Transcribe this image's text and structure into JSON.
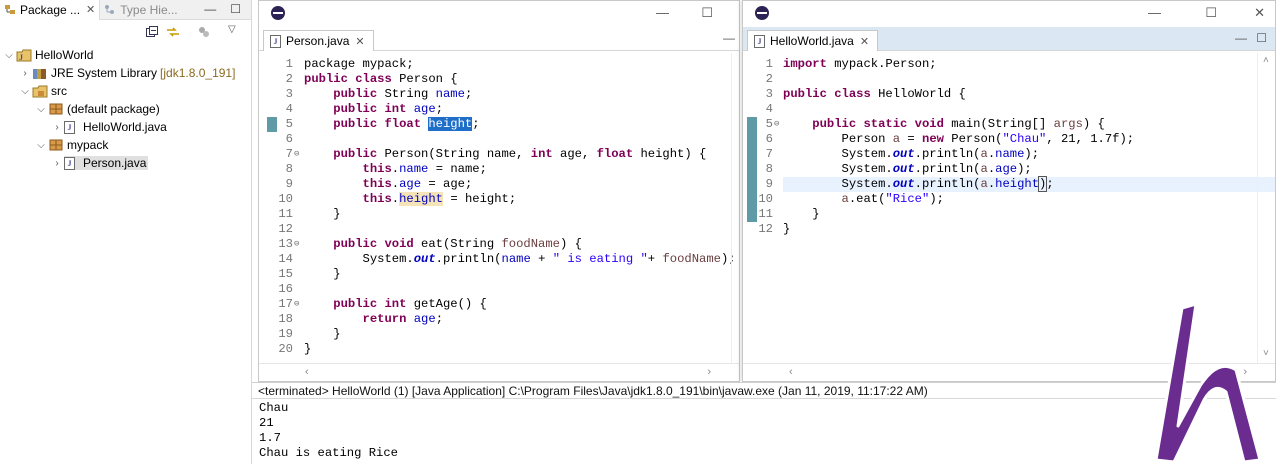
{
  "explorer": {
    "tabs": [
      {
        "label": "Package ...",
        "active": true
      },
      {
        "label": "Type Hie...",
        "active": false
      }
    ],
    "tree": [
      {
        "label": "HelloWorld",
        "level": 0,
        "expanded": true,
        "icon": "project-icon"
      },
      {
        "label": "JRE System Library",
        "extra": "[jdk1.8.0_191]",
        "level": 1,
        "expanded": false,
        "icon": "library-icon"
      },
      {
        "label": "src",
        "level": 1,
        "expanded": true,
        "icon": "source-folder-icon"
      },
      {
        "label": "(default package)",
        "level": 2,
        "expanded": true,
        "icon": "package-icon"
      },
      {
        "label": "HelloWorld.java",
        "level": 3,
        "expanded": false,
        "icon": "java-file-icon"
      },
      {
        "label": "mypack",
        "level": 2,
        "expanded": true,
        "icon": "package-icon"
      },
      {
        "label": "Person.java",
        "level": 3,
        "expanded": false,
        "icon": "java-file-icon",
        "selected": true
      }
    ]
  },
  "editors": {
    "person": {
      "tab": "Person.java",
      "lines": [
        {
          "n": "1",
          "h": "package mypack;"
        },
        {
          "n": "2",
          "h": "<span class=\"kw\">public class</span> Person {"
        },
        {
          "n": "3",
          "h": "    <span class=\"kw\">public</span> String <span class=\"fld\">name</span>;"
        },
        {
          "n": "4",
          "h": "    <span class=\"kw\">public int</span> <span class=\"fld\">age</span>;"
        },
        {
          "n": "5",
          "h": "    <span class=\"kw\">public float</span> <span class=\"hl\">height</span>;"
        },
        {
          "n": "6",
          "h": ""
        },
        {
          "n": "7",
          "fold": true,
          "h": "    <span class=\"kw\">public</span> Person(String name, <span class=\"kw\">int</span> age, <span class=\"kw\">float</span> height) {"
        },
        {
          "n": "8",
          "h": "        <span class=\"kw\">this</span>.<span class=\"fld\">name</span> = name;"
        },
        {
          "n": "9",
          "h": "        <span class=\"kw\">this</span>.<span class=\"fld\">age</span> = age;"
        },
        {
          "n": "10",
          "h": "        <span class=\"kw\">this</span>.<span class=\"fld occ\">height</span> = height;"
        },
        {
          "n": "11",
          "h": "    }"
        },
        {
          "n": "12",
          "h": ""
        },
        {
          "n": "13",
          "fold": true,
          "h": "    <span class=\"kw\">public void</span> eat(String <span class=\"par\">foodName</span>) {"
        },
        {
          "n": "14",
          "h": "        System.<span class=\"sfld\">out</span>.println(<span class=\"fld\">name</span> + <span class=\"str\">\" is eating \"</span>+ <span class=\"par\">foodName</span>);"
        },
        {
          "n": "15",
          "h": "    }"
        },
        {
          "n": "16",
          "h": ""
        },
        {
          "n": "17",
          "fold": true,
          "h": "    <span class=\"kw\">public int</span> getAge() {"
        },
        {
          "n": "18",
          "h": "        <span class=\"kw\">return</span> <span class=\"fld\">age</span>;"
        },
        {
          "n": "19",
          "h": "    }"
        },
        {
          "n": "20",
          "h": "}"
        }
      ]
    },
    "hello": {
      "tab": "HelloWorld.java",
      "lines": [
        {
          "n": "1",
          "h": "<span class=\"kw\">import</span> mypack.Person;"
        },
        {
          "n": "2",
          "h": ""
        },
        {
          "n": "3",
          "h": "<span class=\"kw\">public class</span> HelloWorld {"
        },
        {
          "n": "4",
          "h": ""
        },
        {
          "n": "5",
          "fold": true,
          "h": "    <span class=\"kw\">public static void</span> main(String[] <span class=\"par\">args</span>) {"
        },
        {
          "n": "6",
          "h": "        Person <span class=\"par\">a</span> = <span class=\"kw\">new</span> Person(<span class=\"str\">\"Chau\"</span>, 21, 1.7f);"
        },
        {
          "n": "7",
          "h": "        System.<span class=\"sfld\">out</span>.println(<span class=\"par\">a</span>.<span class=\"fld\">name</span>);"
        },
        {
          "n": "8",
          "h": "        System.<span class=\"sfld\">out</span>.println(<span class=\"par\">a</span>.<span class=\"fld\">age</span>);"
        },
        {
          "n": "9",
          "cur": true,
          "h": "        System.<span class=\"sfld\">out</span>.println(<span class=\"par\">a</span>.<span class=\"fld\">height</span><span class=\"brk\">)</span>;"
        },
        {
          "n": "10",
          "h": "        <span class=\"par\">a</span>.eat(<span class=\"str\">\"Rice\"</span>);"
        },
        {
          "n": "11",
          "h": "    }"
        },
        {
          "n": "12",
          "h": "}"
        }
      ]
    }
  },
  "console": {
    "title": "<terminated> HelloWorld (1) [Java Application] C:\\Program Files\\Java\\jdk1.8.0_191\\bin\\javaw.exe (Jan 11, 2019, 11:17:22 AM)",
    "output": [
      "Chau",
      "21",
      "1.7",
      "Chau is eating Rice"
    ]
  },
  "colors": {
    "keyword": "#7f0055",
    "field": "#0000c0",
    "string": "#2a00ff",
    "selection": "#1f6fc9",
    "logo": "#6b2c8f"
  }
}
